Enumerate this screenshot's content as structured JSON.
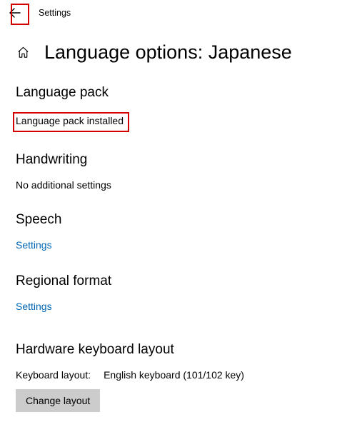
{
  "topbar": {
    "title": "Settings"
  },
  "header": {
    "title": "Language options: Japanese"
  },
  "sections": {
    "language_pack": {
      "heading": "Language pack",
      "status": "Language pack installed"
    },
    "handwriting": {
      "heading": "Handwriting",
      "status": "No additional settings"
    },
    "speech": {
      "heading": "Speech",
      "link": "Settings"
    },
    "regional_format": {
      "heading": "Regional format",
      "link": "Settings"
    },
    "hardware_keyboard": {
      "heading": "Hardware keyboard layout",
      "label": "Keyboard layout:",
      "value": "English keyboard (101/102 key)",
      "button": "Change layout"
    }
  }
}
